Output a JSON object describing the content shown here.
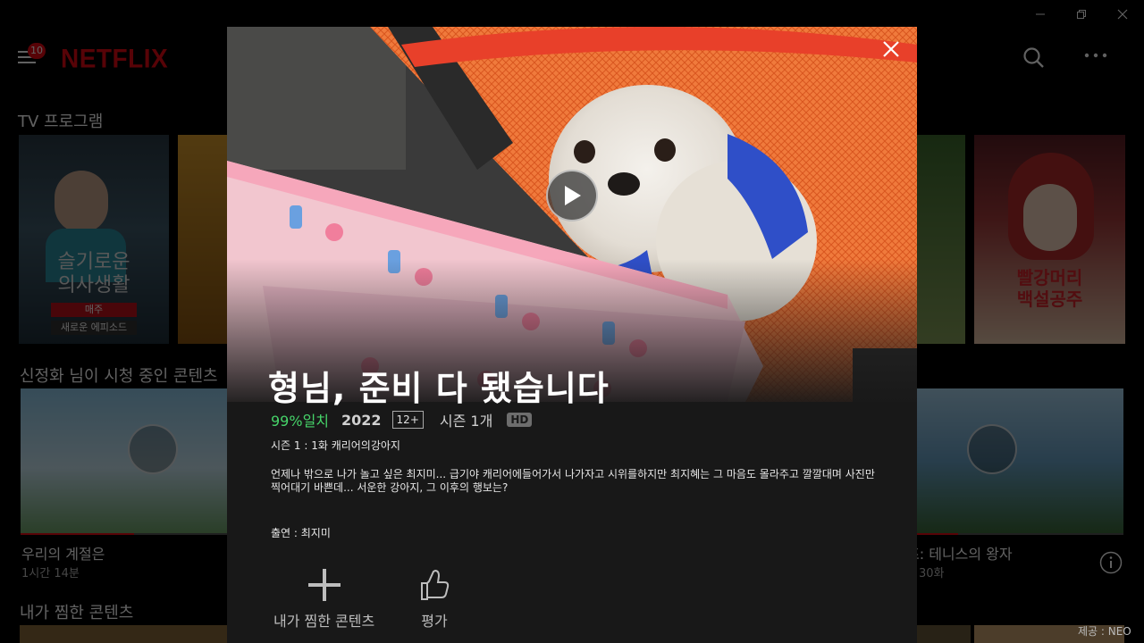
{
  "header": {
    "notification_count": "10",
    "logo": "NETFLIX"
  },
  "rows": {
    "tv_programs": "TV 프로그램",
    "continue_watching": "신정화 님이 시청 중인 콘텐츠",
    "my_list": "내가 찜한 콘텐츠"
  },
  "tiles": {
    "hospital_title": "슬기로운\n의사생활",
    "hospital_day": "매주",
    "hospital_badge": "새로운 에피소드",
    "snow_white_title": "빨강머리\n백설공주",
    "seasons_title": "우리의 계절은",
    "seasons_duration": "1시간 14분",
    "tennis_title": "테니스의 왕자",
    "tennis_prefix": "즈: ",
    "tennis_episodes": "30화"
  },
  "modal": {
    "title": "형님, 준비 다 됐습니다",
    "match": "99%일치",
    "year": "2022",
    "age_rating": "12+",
    "seasons": "시즌 1개",
    "quality": "HD",
    "episode": "시즌 1 : 1화 캐리어의강아지",
    "description": "언제나 밖으로 나가 놀고 싶은 최지미... 급기야 캐리어에들어가서 나가자고 시위를하지만 최지혜는 그 마음도 몰라주고 깔깔대며 사진만 찍어대기 바쁜데... 서운한 강아지, 그 이후의 행보는?",
    "cast": "출연 : 최지미",
    "my_list_label": "내가 찜한 콘텐츠",
    "rate_label": "평가"
  },
  "credit": "제공 : NEO",
  "colors": {
    "brand": "#e50914",
    "match": "#46d369",
    "modal_bg": "#181818"
  },
  "icons": [
    "hamburger-icon",
    "search-icon",
    "more-icon",
    "minimize-icon",
    "restore-icon",
    "close-icon",
    "play-icon",
    "plus-icon",
    "thumbs-up-icon",
    "info-icon"
  ]
}
